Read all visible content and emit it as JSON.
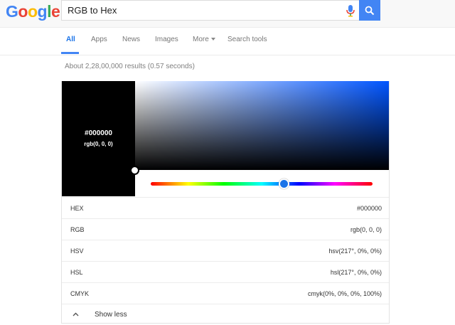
{
  "logo": {
    "letters": [
      "G",
      "o",
      "o",
      "g",
      "l",
      "e"
    ],
    "colors": [
      "#4285f4",
      "#ea4335",
      "#fbbc05",
      "#4285f4",
      "#34a853",
      "#ea4335"
    ]
  },
  "search": {
    "value": "RGB to Hex"
  },
  "tabs": {
    "all": "All",
    "apps": "Apps",
    "news": "News",
    "images": "Images",
    "more": "More",
    "search_tools": "Search tools"
  },
  "results_count": "About 2,28,00,000 results (0.57 seconds)",
  "picker": {
    "hex": "#000000",
    "rgb": "rgb(0, 0, 0)",
    "hue_fraction": 0.6,
    "accent": "#4285f4"
  },
  "rows": [
    {
      "label": "HEX",
      "value": "#000000"
    },
    {
      "label": "RGB",
      "value": "rgb(0, 0, 0)"
    },
    {
      "label": "HSV",
      "value": "hsv(217°, 0%, 0%)"
    },
    {
      "label": "HSL",
      "value": "hsl(217°, 0%, 0%)"
    },
    {
      "label": "CMYK",
      "value": "cmyk(0%, 0%, 0%, 100%)"
    }
  ],
  "show_less": "Show less"
}
